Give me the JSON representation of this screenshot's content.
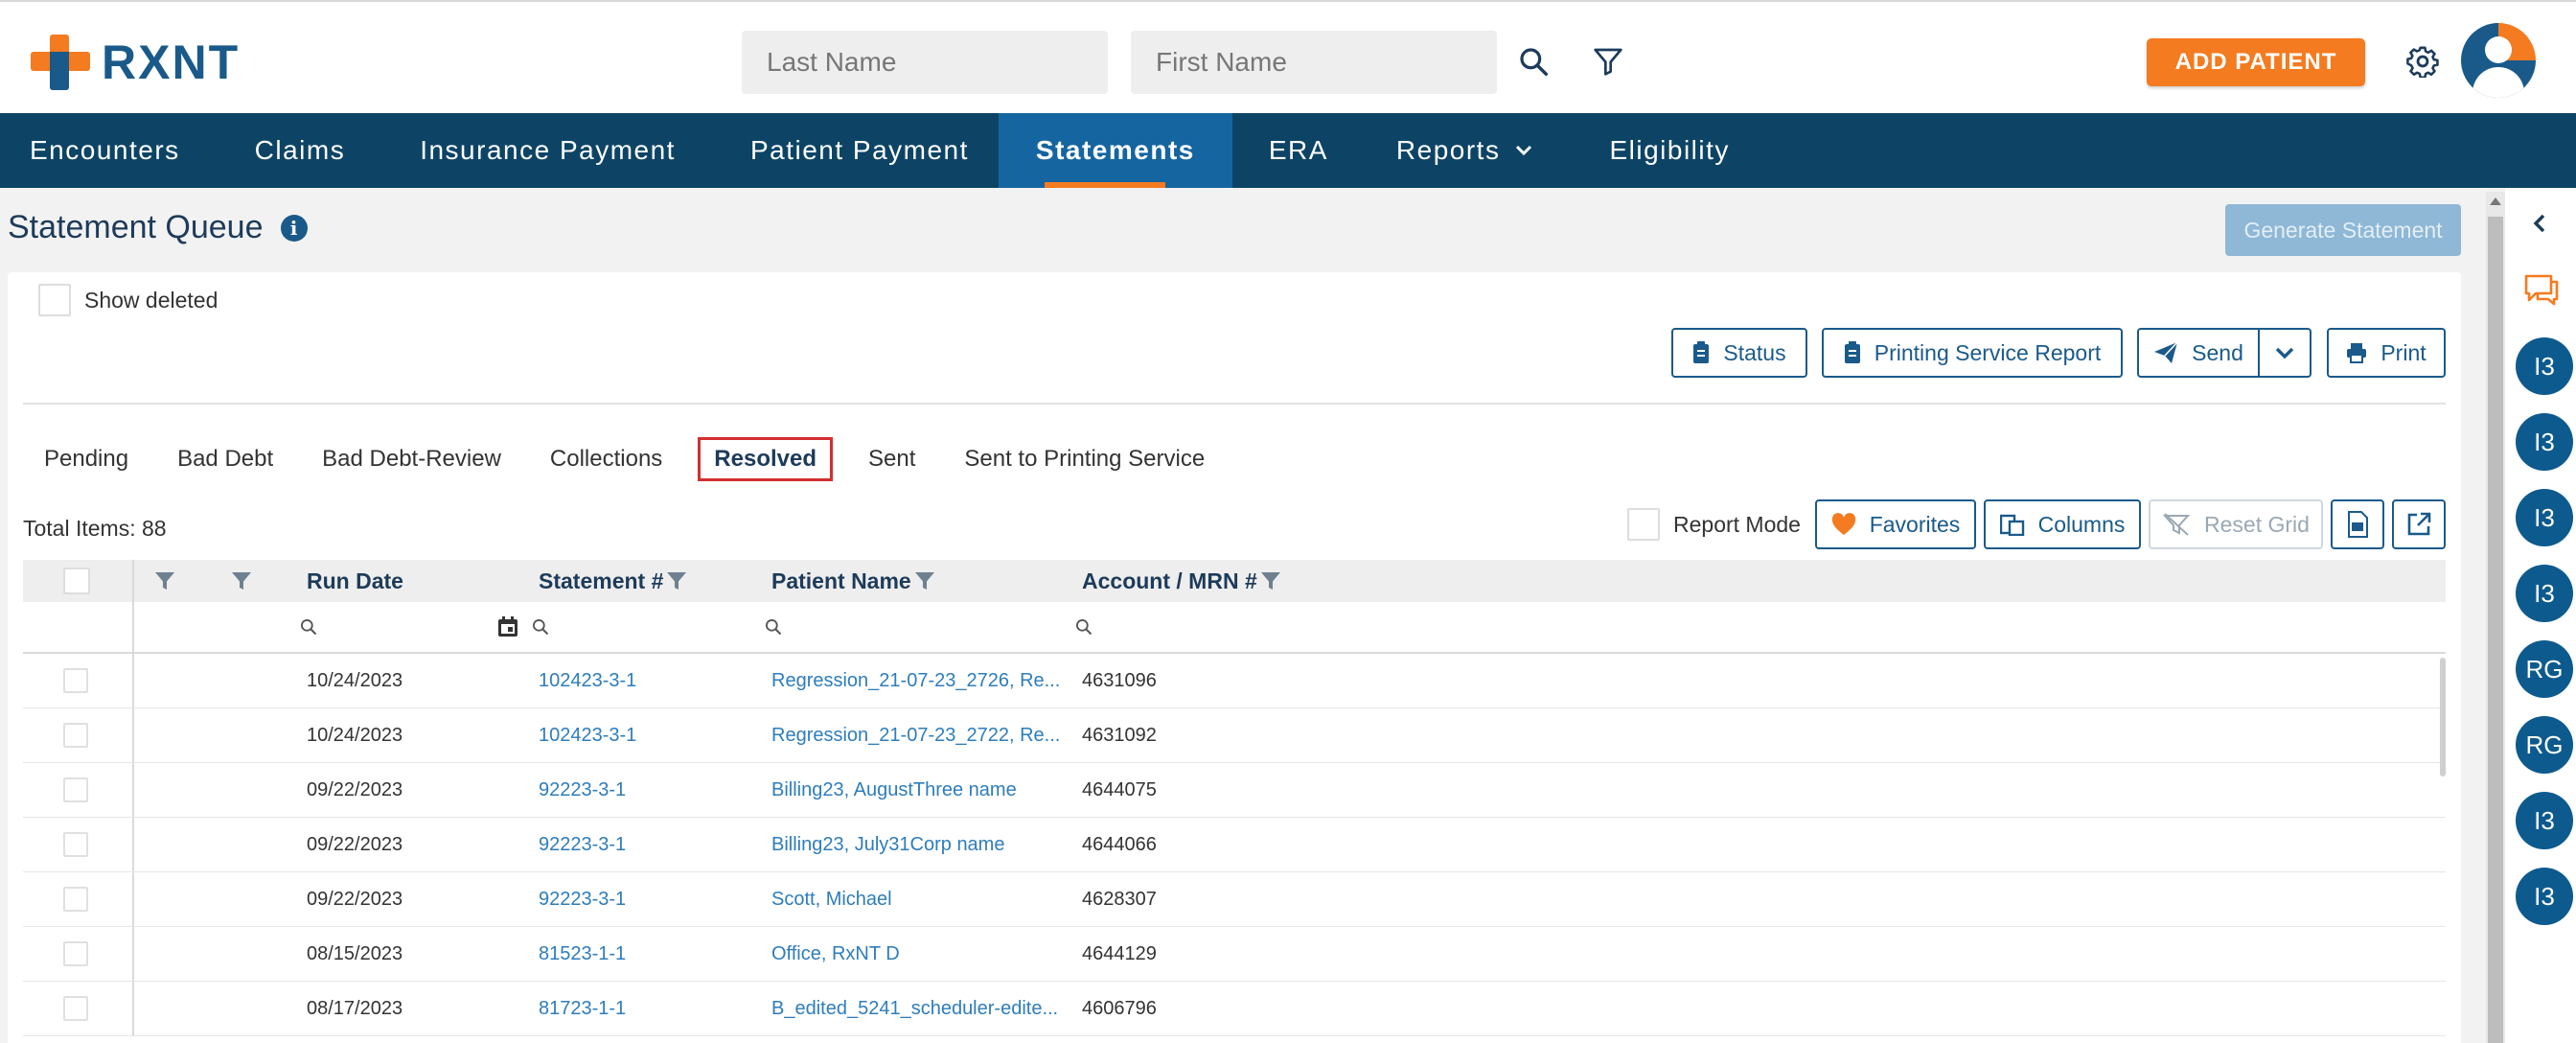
{
  "app": {
    "logo_text": "RXNT"
  },
  "header": {
    "last_name_placeholder": "Last Name",
    "first_name_placeholder": "First Name",
    "add_patient_label": "ADD PATIENT"
  },
  "nav": {
    "items": [
      {
        "label": "Encounters"
      },
      {
        "label": "Claims"
      },
      {
        "label": "Insurance Payment"
      },
      {
        "label": "Patient Payment"
      },
      {
        "label": "Statements",
        "active": true
      },
      {
        "label": "ERA"
      },
      {
        "label": "Reports",
        "dropdown": true
      },
      {
        "label": "Eligibility"
      }
    ]
  },
  "page": {
    "title": "Statement Queue",
    "generate_statement_label": "Generate Statement",
    "show_deleted_label": "Show deleted",
    "actions": {
      "status": "Status",
      "printing_service_report": "Printing Service Report",
      "send": "Send",
      "print": "Print"
    },
    "tabs": [
      {
        "label": "Pending"
      },
      {
        "label": "Bad Debt"
      },
      {
        "label": "Bad Debt-Review"
      },
      {
        "label": "Collections"
      },
      {
        "label": "Resolved",
        "active": true
      },
      {
        "label": "Sent"
      },
      {
        "label": "Sent to Printing Service"
      }
    ],
    "total_items": "Total Items: 88",
    "report_mode_label": "Report Mode",
    "toolbar": {
      "favorites": "Favorites",
      "columns": "Columns",
      "reset_grid": "Reset Grid"
    }
  },
  "grid": {
    "columns": {
      "run_date": "Run Date",
      "statement": "Statement #",
      "patient_name": "Patient Name",
      "account": "Account / MRN #"
    },
    "rows": [
      {
        "run_date": "10/24/2023",
        "statement": "102423-3-1",
        "patient": "Regression_21-07-23_2726, Re...",
        "account": "4631096"
      },
      {
        "run_date": "10/24/2023",
        "statement": "102423-3-1",
        "patient": "Regression_21-07-23_2722, Re...",
        "account": "4631092"
      },
      {
        "run_date": "09/22/2023",
        "statement": "92223-3-1",
        "patient": "Billing23, AugustThree name",
        "account": "4644075"
      },
      {
        "run_date": "09/22/2023",
        "statement": "92223-3-1",
        "patient": "Billing23, July31Corp name",
        "account": "4644066"
      },
      {
        "run_date": "09/22/2023",
        "statement": "92223-3-1",
        "patient": "Scott, Michael",
        "account": "4628307"
      },
      {
        "run_date": "08/15/2023",
        "statement": "81523-1-1",
        "patient": "Office, RxNT D",
        "account": "4644129"
      },
      {
        "run_date": "08/17/2023",
        "statement": "81723-1-1",
        "patient": "B_edited_5241_scheduler-edite...",
        "account": "4606796"
      }
    ]
  },
  "rail": {
    "bubbles": [
      "I3",
      "I3",
      "I3",
      "I3",
      "RG",
      "RG",
      "I3",
      "I3"
    ]
  },
  "colors": {
    "brand_orange": "#f47b20",
    "brand_blue": "#1a5a8a",
    "nav_bg": "#0d4466",
    "nav_active": "#1565a0"
  }
}
